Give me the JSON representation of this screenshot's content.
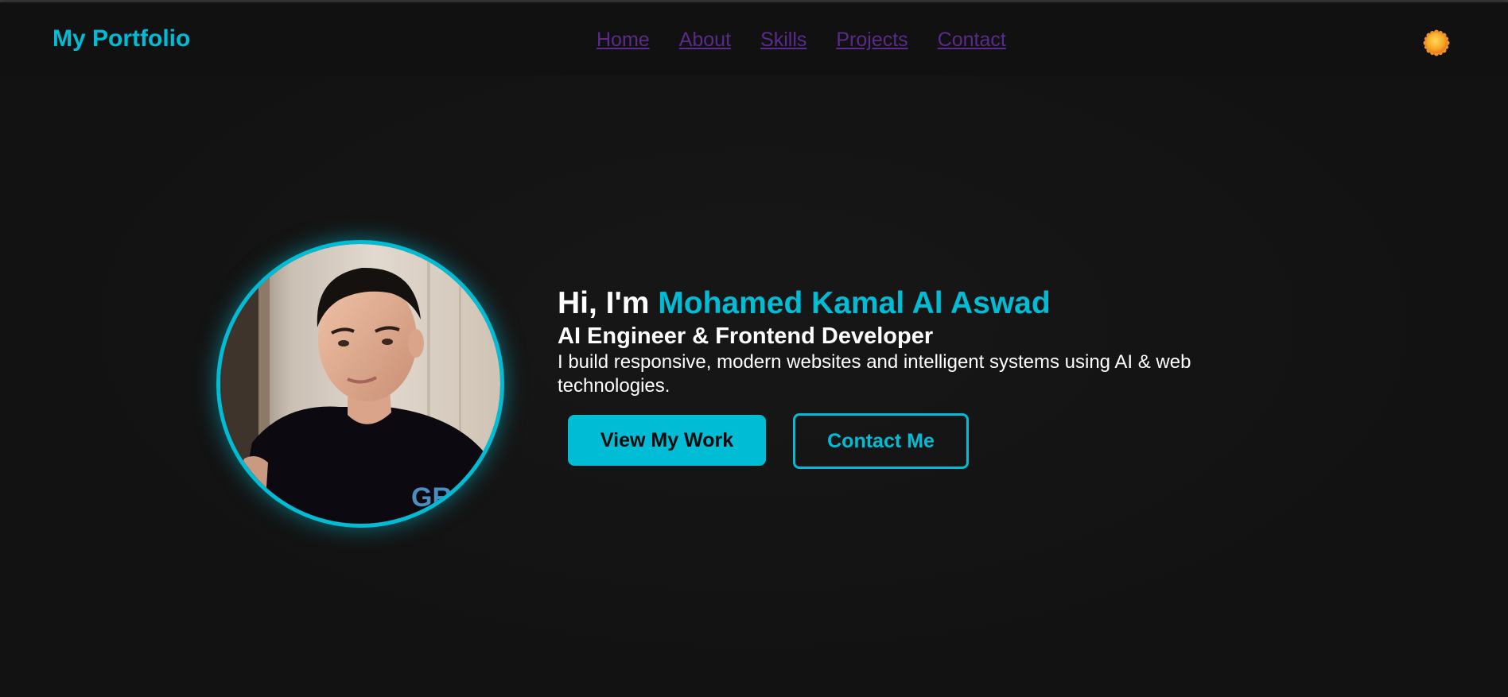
{
  "header": {
    "logo": "My Portfolio",
    "nav": [
      {
        "label": "Home"
      },
      {
        "label": "About"
      },
      {
        "label": "Skills"
      },
      {
        "label": "Projects"
      },
      {
        "label": "Contact"
      }
    ],
    "theme_toggle_icon": "sun-icon"
  },
  "hero": {
    "greeting_prefix": "Hi, I'm ",
    "name": "Mohamed Kamal Al Aswad",
    "role": "AI Engineer & Frontend Developer",
    "description": "I build responsive, modern websites and intelligent systems using AI & web technologies.",
    "primary_button": "View My Work",
    "secondary_button": "Contact Me"
  },
  "colors": {
    "accent": "#00bcd4",
    "background": "#141414",
    "nav_link": "#5b2a8a",
    "text": "#ffffff"
  }
}
